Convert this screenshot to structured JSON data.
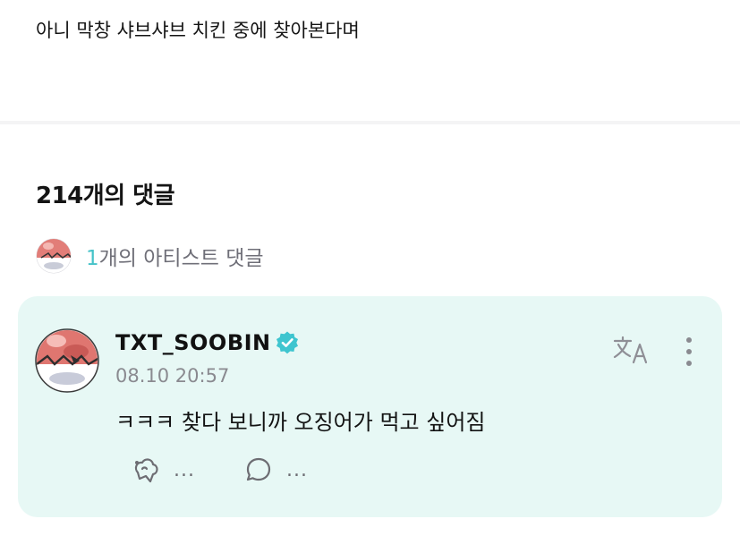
{
  "post": {
    "text": "아니 막창 샤브샤브 치킨 중에 찾아본다며"
  },
  "comments_header": {
    "count_label": "214개의 댓글"
  },
  "artist_comments": {
    "count": "1",
    "label_suffix": "개의 아티스트 댓글"
  },
  "comment": {
    "username": "TXT_SOOBIN",
    "timestamp": "08.10 20:57",
    "text": "ㅋㅋㅋ 찾다 보니까 오징어가 먹고 싶어짐",
    "like_count": "...",
    "reply_count": "..."
  },
  "colors": {
    "card_bg": "#e7f8f5",
    "accent": "#46c3c9",
    "verified": "#3ec5cf"
  },
  "icons": [
    "avatar-icon",
    "verified-icon",
    "translate-icon",
    "more-options-icon",
    "like-icon",
    "reply-icon"
  ]
}
